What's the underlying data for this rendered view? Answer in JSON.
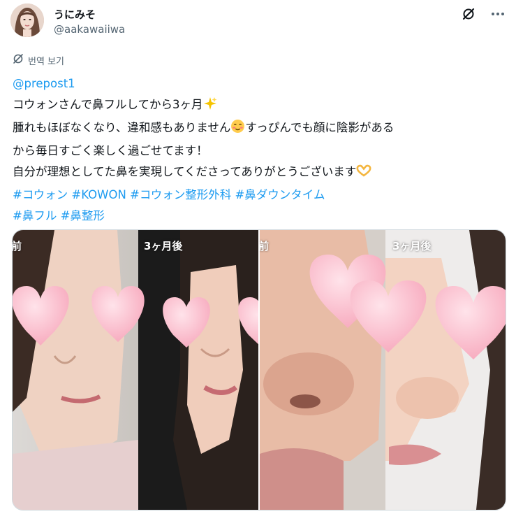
{
  "user": {
    "display_name": "うにみそ",
    "handle": "@aakawaiiwa",
    "avatar_icon": "profile-photo"
  },
  "header_icons": [
    "grok-icon",
    "more-icon"
  ],
  "translate": {
    "label": "번역 보기",
    "icon": "translate-icon"
  },
  "tweet": {
    "mention": "@prepost1",
    "line1": "コウォンさんで鼻フルしてから3ヶ月",
    "line2a": "腫れもほぼなくなり、違和感もありません",
    "line2b": "すっぴんでも顔に陰影がある",
    "line3": "から毎日すごく楽しく過ごせてます！",
    "line4": "自分が理想としてた鼻を実現してくださってありがとうございます",
    "hashtags_line1": [
      "#コウォン",
      "#KOWON",
      "#コウォン整形外科",
      "#鼻ダウンタイム"
    ],
    "hashtags_line2": [
      "#鼻フル",
      "#鼻整形"
    ],
    "emoji": [
      "sparkles-emoji",
      "smiling-blush-emoji",
      "heart-hands-emoji"
    ]
  },
  "media": {
    "photo1_label_left": "前",
    "photo1_label_right": "3ヶ月後",
    "photo2_label_left": "前",
    "photo2_label_right": "3ヶ月後"
  },
  "colors": {
    "link": "#1d9bf0",
    "text": "#0f1419",
    "secondary": "#536471"
  }
}
